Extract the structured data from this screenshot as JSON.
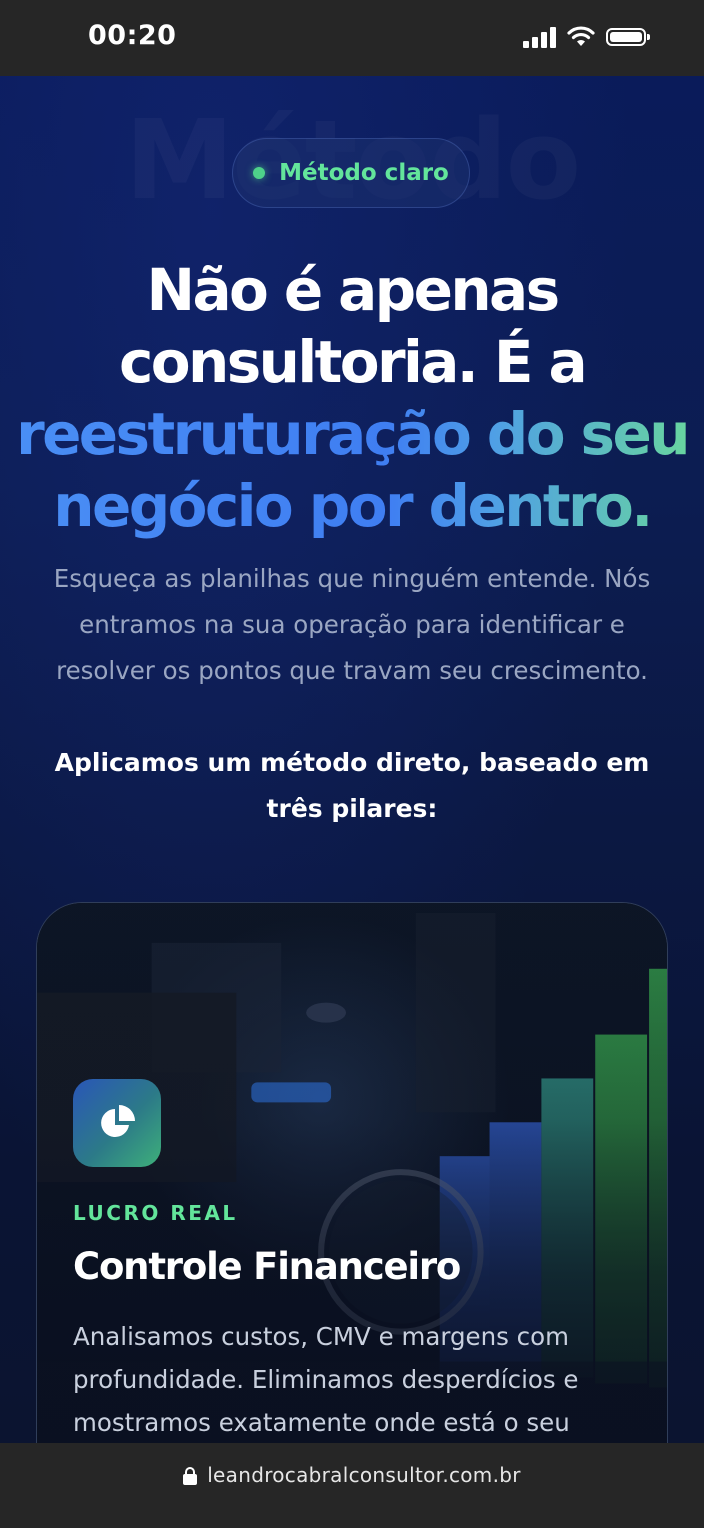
{
  "status_bar": {
    "time": "00:20",
    "icons": [
      "cellular-signal-icon",
      "wifi-icon",
      "battery-icon"
    ]
  },
  "hero": {
    "watermark": "Método",
    "badge": {
      "label": "Método claro",
      "dot_color": "#4ed28a"
    },
    "headline": {
      "line1": "Não é apenas",
      "line2": "consultoria. É a",
      "line3": "reestruturação do seu",
      "line4": "negócio por dentro."
    },
    "subtitle": "Esqueça as planilhas que ninguém entende. Nós entramos na sua operação para identificar e resolver os pontos que travam seu crescimento.",
    "pillars_intro": "Aplicamos um método direto, baseado em três pilares:"
  },
  "card": {
    "icon": "pie-chart-icon",
    "kicker": "LUCRO REAL",
    "title": "Controle Financeiro",
    "description": "Analisamos custos, CMV e margens com profundidade. Eliminamos desperdícios e mostramos exatamente onde está o seu"
  },
  "browser": {
    "url": "leandrocabralconsultor.com.br",
    "icon": "lock-icon"
  },
  "colors": {
    "accent_green": "#63e59b",
    "accent_blue": "#4a8ff5",
    "background": "#0a1b5a"
  }
}
